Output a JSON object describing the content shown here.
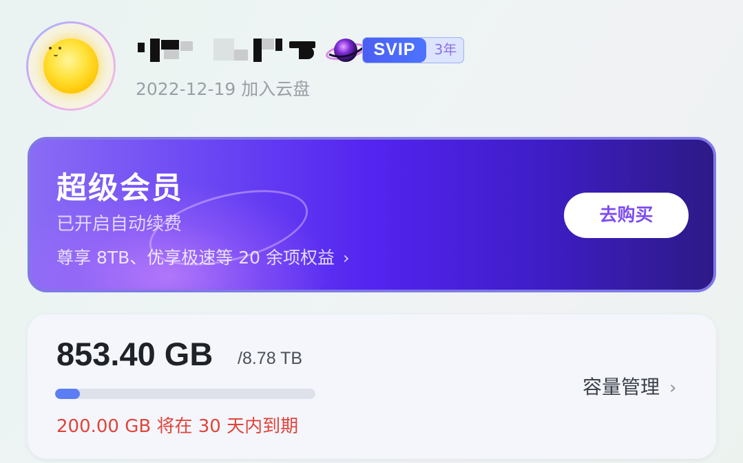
{
  "profile": {
    "join_date": "2022-12-19 加入云盘",
    "badge": {
      "tier": "SVIP",
      "years": "3年"
    }
  },
  "vip_card": {
    "title": "超级会员",
    "status": "已开启自动续费",
    "benefits": "尊享 8TB、优享极速等 20 余项权益",
    "buy_label": "去购买"
  },
  "storage": {
    "used": "853.40 GB",
    "total": "/8.78 TB",
    "used_fraction": 0.095,
    "expire_notice": "200.00 GB 将在 30 天内到期",
    "manage_label": "容量管理"
  },
  "icons": [
    "avatar-sun-icon",
    "planet-icon",
    "chevron-right-icon"
  ],
  "colors": {
    "svip_blue": "#4b5ff2",
    "vip_purple": "#5424f0",
    "expire_red": "#e0443a",
    "bar_fill": "#5b7ef5"
  }
}
